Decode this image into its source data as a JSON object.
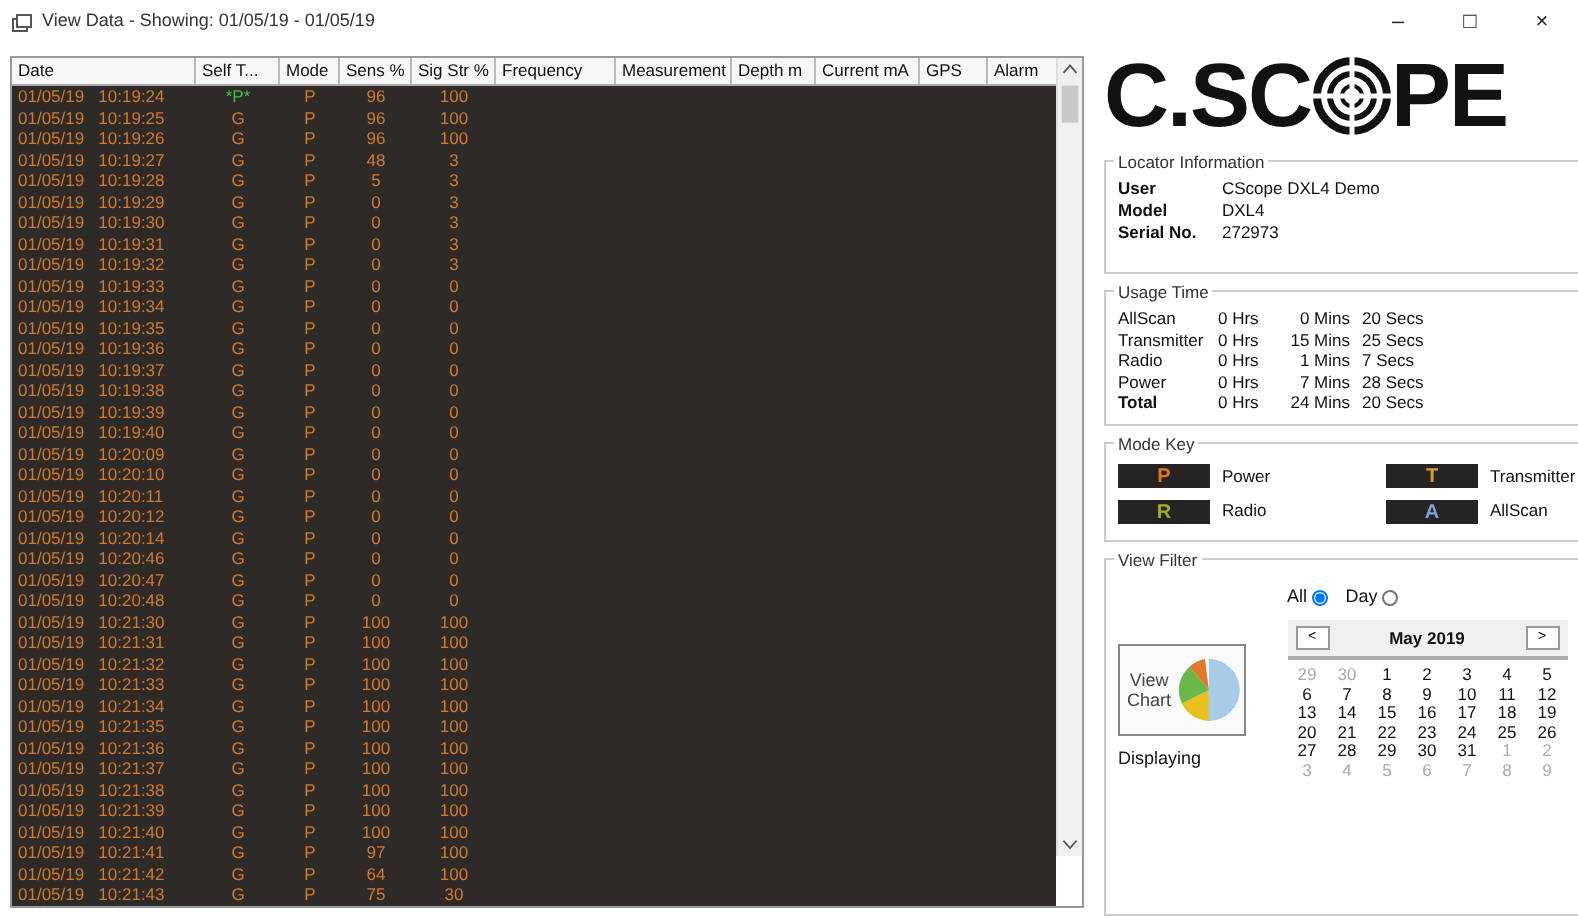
{
  "window": {
    "title": "View Data - Showing: 01/05/19 - 01/05/19",
    "controls": [
      "–",
      "□",
      "×"
    ]
  },
  "table": {
    "columns": [
      "Date",
      "Self T...",
      "Mode",
      "Sens %",
      "Sig Str %",
      "Frequency",
      "Measurement",
      "Depth m",
      "Current mA",
      "GPS",
      "Alarm"
    ],
    "rows": [
      {
        "date": "01/05/19",
        "time": "10:19:24",
        "self_test": "*P*",
        "self_test_passed": true,
        "mode": "P",
        "sens": "96",
        "sig": "100"
      },
      {
        "date": "01/05/19",
        "time": "10:19:25",
        "self_test": "G",
        "self_test_passed": false,
        "mode": "P",
        "sens": "96",
        "sig": "100"
      },
      {
        "date": "01/05/19",
        "time": "10:19:26",
        "self_test": "G",
        "self_test_passed": false,
        "mode": "P",
        "sens": "96",
        "sig": "100"
      },
      {
        "date": "01/05/19",
        "time": "10:19:27",
        "self_test": "G",
        "self_test_passed": false,
        "mode": "P",
        "sens": "48",
        "sig": "3"
      },
      {
        "date": "01/05/19",
        "time": "10:19:28",
        "self_test": "G",
        "self_test_passed": false,
        "mode": "P",
        "sens": "5",
        "sig": "3"
      },
      {
        "date": "01/05/19",
        "time": "10:19:29",
        "self_test": "G",
        "self_test_passed": false,
        "mode": "P",
        "sens": "0",
        "sig": "3"
      },
      {
        "date": "01/05/19",
        "time": "10:19:30",
        "self_test": "G",
        "self_test_passed": false,
        "mode": "P",
        "sens": "0",
        "sig": "3"
      },
      {
        "date": "01/05/19",
        "time": "10:19:31",
        "self_test": "G",
        "self_test_passed": false,
        "mode": "P",
        "sens": "0",
        "sig": "3"
      },
      {
        "date": "01/05/19",
        "time": "10:19:32",
        "self_test": "G",
        "self_test_passed": false,
        "mode": "P",
        "sens": "0",
        "sig": "3"
      },
      {
        "date": "01/05/19",
        "time": "10:19:33",
        "self_test": "G",
        "self_test_passed": false,
        "mode": "P",
        "sens": "0",
        "sig": "0"
      },
      {
        "date": "01/05/19",
        "time": "10:19:34",
        "self_test": "G",
        "self_test_passed": false,
        "mode": "P",
        "sens": "0",
        "sig": "0"
      },
      {
        "date": "01/05/19",
        "time": "10:19:35",
        "self_test": "G",
        "self_test_passed": false,
        "mode": "P",
        "sens": "0",
        "sig": "0"
      },
      {
        "date": "01/05/19",
        "time": "10:19:36",
        "self_test": "G",
        "self_test_passed": false,
        "mode": "P",
        "sens": "0",
        "sig": "0"
      },
      {
        "date": "01/05/19",
        "time": "10:19:37",
        "self_test": "G",
        "self_test_passed": false,
        "mode": "P",
        "sens": "0",
        "sig": "0"
      },
      {
        "date": "01/05/19",
        "time": "10:19:38",
        "self_test": "G",
        "self_test_passed": false,
        "mode": "P",
        "sens": "0",
        "sig": "0"
      },
      {
        "date": "01/05/19",
        "time": "10:19:39",
        "self_test": "G",
        "self_test_passed": false,
        "mode": "P",
        "sens": "0",
        "sig": "0"
      },
      {
        "date": "01/05/19",
        "time": "10:19:40",
        "self_test": "G",
        "self_test_passed": false,
        "mode": "P",
        "sens": "0",
        "sig": "0"
      },
      {
        "date": "01/05/19",
        "time": "10:20:09",
        "self_test": "G",
        "self_test_passed": false,
        "mode": "P",
        "sens": "0",
        "sig": "0"
      },
      {
        "date": "01/05/19",
        "time": "10:20:10",
        "self_test": "G",
        "self_test_passed": false,
        "mode": "P",
        "sens": "0",
        "sig": "0"
      },
      {
        "date": "01/05/19",
        "time": "10:20:11",
        "self_test": "G",
        "self_test_passed": false,
        "mode": "P",
        "sens": "0",
        "sig": "0"
      },
      {
        "date": "01/05/19",
        "time": "10:20:12",
        "self_test": "G",
        "self_test_passed": false,
        "mode": "P",
        "sens": "0",
        "sig": "0"
      },
      {
        "date": "01/05/19",
        "time": "10:20:14",
        "self_test": "G",
        "self_test_passed": false,
        "mode": "P",
        "sens": "0",
        "sig": "0"
      },
      {
        "date": "01/05/19",
        "time": "10:20:46",
        "self_test": "G",
        "self_test_passed": false,
        "mode": "P",
        "sens": "0",
        "sig": "0"
      },
      {
        "date": "01/05/19",
        "time": "10:20:47",
        "self_test": "G",
        "self_test_passed": false,
        "mode": "P",
        "sens": "0",
        "sig": "0"
      },
      {
        "date": "01/05/19",
        "time": "10:20:48",
        "self_test": "G",
        "self_test_passed": false,
        "mode": "P",
        "sens": "0",
        "sig": "0"
      },
      {
        "date": "01/05/19",
        "time": "10:21:30",
        "self_test": "G",
        "self_test_passed": false,
        "mode": "P",
        "sens": "100",
        "sig": "100"
      },
      {
        "date": "01/05/19",
        "time": "10:21:31",
        "self_test": "G",
        "self_test_passed": false,
        "mode": "P",
        "sens": "100",
        "sig": "100"
      },
      {
        "date": "01/05/19",
        "time": "10:21:32",
        "self_test": "G",
        "self_test_passed": false,
        "mode": "P",
        "sens": "100",
        "sig": "100"
      },
      {
        "date": "01/05/19",
        "time": "10:21:33",
        "self_test": "G",
        "self_test_passed": false,
        "mode": "P",
        "sens": "100",
        "sig": "100"
      },
      {
        "date": "01/05/19",
        "time": "10:21:34",
        "self_test": "G",
        "self_test_passed": false,
        "mode": "P",
        "sens": "100",
        "sig": "100"
      },
      {
        "date": "01/05/19",
        "time": "10:21:35",
        "self_test": "G",
        "self_test_passed": false,
        "mode": "P",
        "sens": "100",
        "sig": "100"
      },
      {
        "date": "01/05/19",
        "time": "10:21:36",
        "self_test": "G",
        "self_test_passed": false,
        "mode": "P",
        "sens": "100",
        "sig": "100"
      },
      {
        "date": "01/05/19",
        "time": "10:21:37",
        "self_test": "G",
        "self_test_passed": false,
        "mode": "P",
        "sens": "100",
        "sig": "100"
      },
      {
        "date": "01/05/19",
        "time": "10:21:38",
        "self_test": "G",
        "self_test_passed": false,
        "mode": "P",
        "sens": "100",
        "sig": "100"
      },
      {
        "date": "01/05/19",
        "time": "10:21:39",
        "self_test": "G",
        "self_test_passed": false,
        "mode": "P",
        "sens": "100",
        "sig": "100"
      },
      {
        "date": "01/05/19",
        "time": "10:21:40",
        "self_test": "G",
        "self_test_passed": false,
        "mode": "P",
        "sens": "100",
        "sig": "100"
      },
      {
        "date": "01/05/19",
        "time": "10:21:41",
        "self_test": "G",
        "self_test_passed": false,
        "mode": "P",
        "sens": "97",
        "sig": "100"
      },
      {
        "date": "01/05/19",
        "time": "10:21:42",
        "self_test": "G",
        "self_test_passed": false,
        "mode": "P",
        "sens": "64",
        "sig": "100"
      },
      {
        "date": "01/05/19",
        "time": "10:21:43",
        "self_test": "G",
        "self_test_passed": false,
        "mode": "P",
        "sens": "75",
        "sig": "30"
      }
    ]
  },
  "logo": {
    "before": "C.SC",
    "after": "PE"
  },
  "locator": {
    "title": "Locator Information",
    "fields": [
      {
        "label": "User",
        "value": "CScope DXL4 Demo"
      },
      {
        "label": "Model",
        "value": "DXL4"
      },
      {
        "label": "Serial No.",
        "value": "272973"
      }
    ]
  },
  "usage": {
    "title": "Usage Time",
    "rows": [
      {
        "label": "AllScan",
        "hrs": "0 Hrs",
        "mins": "0 Mins",
        "secs": "20 Secs",
        "total": false
      },
      {
        "label": "Transmitter",
        "hrs": "0 Hrs",
        "mins": "15 Mins",
        "secs": "25 Secs",
        "total": false
      },
      {
        "label": "Radio",
        "hrs": "0 Hrs",
        "mins": "1 Mins",
        "secs": "7 Secs",
        "total": false
      },
      {
        "label": "Power",
        "hrs": "0 Hrs",
        "mins": "7 Mins",
        "secs": "28 Secs",
        "total": false
      },
      {
        "label": "Total",
        "hrs": "0 Hrs",
        "mins": "24 Mins",
        "secs": "20 Secs",
        "total": true
      }
    ]
  },
  "mode_key": {
    "title": "Mode Key",
    "items": [
      {
        "code": "P",
        "label": "Power",
        "color": "#e07a20"
      },
      {
        "code": "T",
        "label": "Transmitter",
        "color": "#d8a020"
      },
      {
        "code": "R",
        "label": "Radio",
        "color": "#a0b020"
      },
      {
        "code": "A",
        "label": "AllScan",
        "color": "#7aa0d8"
      }
    ]
  },
  "view_filter": {
    "title": "View Filter",
    "options": [
      {
        "label": "All",
        "selected": true
      },
      {
        "label": "Day",
        "selected": false
      }
    ],
    "view_chart": "View Chart",
    "displaying": "Displaying",
    "calendar": {
      "prev": "<",
      "next": ">",
      "month": "May 2019",
      "days": [
        {
          "d": "29",
          "other": true
        },
        {
          "d": "30",
          "other": true
        },
        {
          "d": "1",
          "other": false
        },
        {
          "d": "2",
          "other": false
        },
        {
          "d": "3",
          "other": false
        },
        {
          "d": "4",
          "other": false
        },
        {
          "d": "5",
          "other": false
        },
        {
          "d": "6",
          "other": false
        },
        {
          "d": "7",
          "other": false
        },
        {
          "d": "8",
          "other": false
        },
        {
          "d": "9",
          "other": false
        },
        {
          "d": "10",
          "other": false
        },
        {
          "d": "11",
          "other": false
        },
        {
          "d": "12",
          "other": false
        },
        {
          "d": "13",
          "other": false
        },
        {
          "d": "14",
          "other": false
        },
        {
          "d": "15",
          "other": false
        },
        {
          "d": "16",
          "other": false
        },
        {
          "d": "17",
          "other": false
        },
        {
          "d": "18",
          "other": false
        },
        {
          "d": "19",
          "other": false
        },
        {
          "d": "20",
          "other": false
        },
        {
          "d": "21",
          "other": false
        },
        {
          "d": "22",
          "other": false
        },
        {
          "d": "23",
          "other": false
        },
        {
          "d": "24",
          "other": false
        },
        {
          "d": "25",
          "other": false
        },
        {
          "d": "26",
          "other": false
        },
        {
          "d": "27",
          "other": false
        },
        {
          "d": "28",
          "other": false
        },
        {
          "d": "29",
          "other": false
        },
        {
          "d": "30",
          "other": false
        },
        {
          "d": "31",
          "other": false
        },
        {
          "d": "1",
          "other": true
        },
        {
          "d": "2",
          "other": true
        },
        {
          "d": "3",
          "other": true
        },
        {
          "d": "4",
          "other": true
        },
        {
          "d": "5",
          "other": true
        },
        {
          "d": "6",
          "other": true
        },
        {
          "d": "7",
          "other": true
        },
        {
          "d": "8",
          "other": true
        },
        {
          "d": "9",
          "other": true
        }
      ]
    }
  }
}
